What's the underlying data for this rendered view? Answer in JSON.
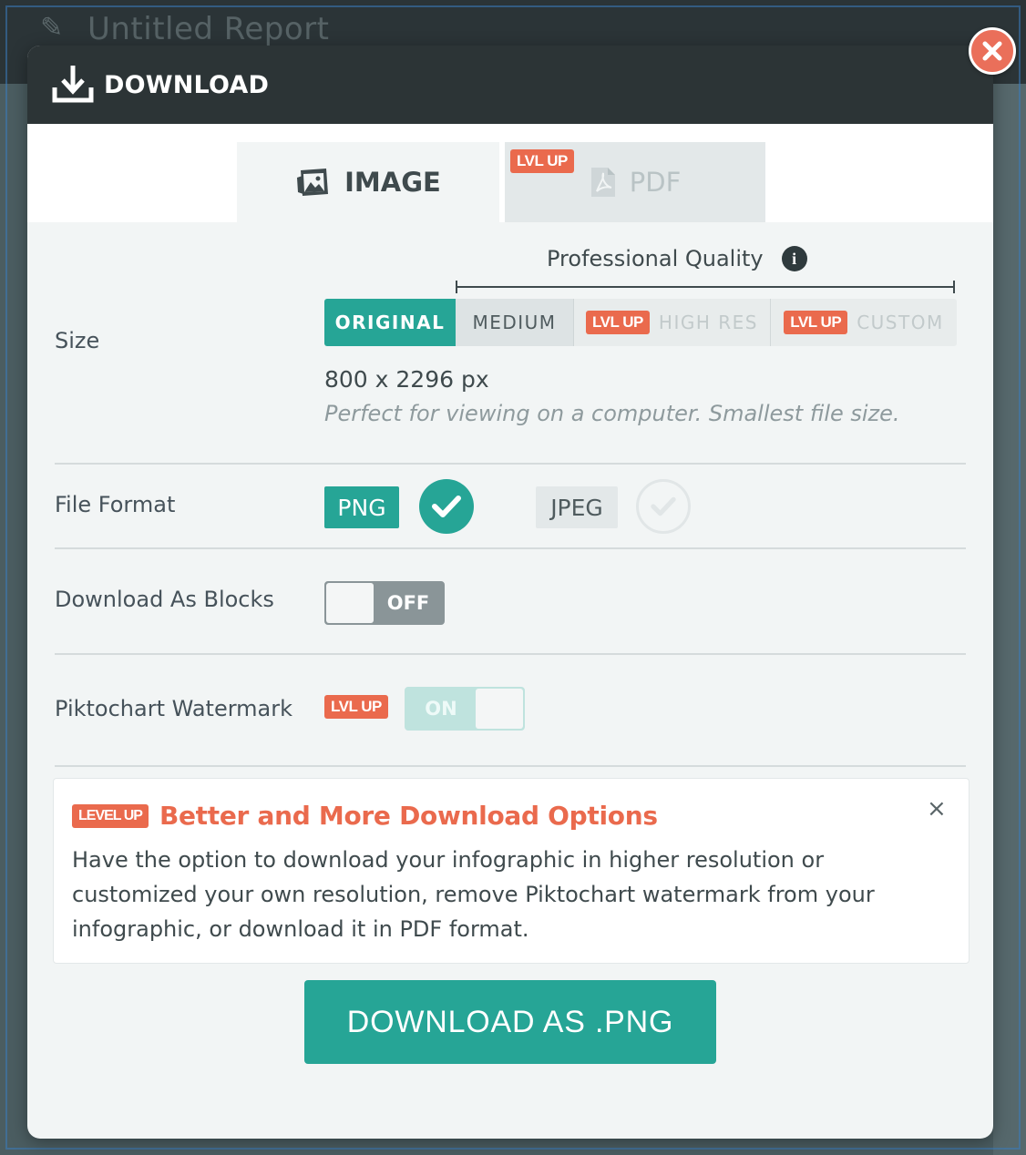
{
  "background": {
    "document_title": "Untitled Report"
  },
  "modal": {
    "title": "DOWNLOAD",
    "close_icon": "close-icon"
  },
  "tabs": [
    {
      "label": "IMAGE",
      "icon": "image-icon",
      "selected": true
    },
    {
      "label": "PDF",
      "icon": "pdf-icon",
      "badge": "LVL UP",
      "selected": false
    }
  ],
  "size": {
    "label": "Size",
    "quality_label": "Professional Quality",
    "info_icon": "i",
    "options": [
      {
        "label": "ORIGINAL",
        "selected": true
      },
      {
        "label": "MEDIUM",
        "selected": false
      },
      {
        "label": "HIGH RES",
        "badge": "LVL UP",
        "locked": true
      },
      {
        "label": "CUSTOM",
        "badge": "LVL UP",
        "locked": true
      }
    ],
    "dimensions": "800 x 2296 px",
    "description": "Perfect for viewing on a computer. Smallest file size."
  },
  "file_format": {
    "label": "File Format",
    "options": [
      {
        "label": "PNG",
        "selected": true
      },
      {
        "label": "JPEG",
        "selected": false
      }
    ]
  },
  "download_as_blocks": {
    "label": "Download As Blocks",
    "state": "OFF"
  },
  "watermark": {
    "label": "Piktochart Watermark",
    "badge": "LVL UP",
    "state": "ON"
  },
  "upsell": {
    "badge": "LEVEL UP",
    "title": "Better and More Download Options",
    "close": "×",
    "body": "Have the option to download your infographic in higher resolution or customized your own resolution, remove Piktochart watermark from your infographic, or download it in PDF format."
  },
  "download_button": {
    "label": "DOWNLOAD AS .PNG"
  },
  "colors": {
    "accent": "#26a596",
    "badge": "#ea6a4d",
    "header": "#2c3436"
  }
}
